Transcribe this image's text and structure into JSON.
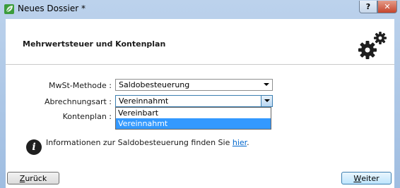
{
  "window": {
    "title": "Neues Dossier *",
    "help_label": "?",
    "close_label": "✕"
  },
  "header": {
    "title": "Mehrwertsteuer und Kontenplan",
    "icon": "gears-icon"
  },
  "form": {
    "mwst_label": "MwSt-Methode :",
    "mwst_value": "Saldobesteuerung",
    "abrechnungsart_label": "Abrechnungsart :",
    "abrechnungsart_value": "Vereinnahmt",
    "kontenplan_label": "Kontenplan :"
  },
  "dropdown": {
    "options": [
      "Vereinbart",
      "Vereinnahmt"
    ],
    "selected_index": 1
  },
  "info": {
    "text": "Informationen zur Saldobesteuerung finden Sie ",
    "link": "hier",
    "suffix": "."
  },
  "buttons": {
    "back_first": "Z",
    "back_rest": "urück",
    "next_first": "W",
    "next_rest": "eiter"
  },
  "colors": {
    "selection": "#3399ff",
    "link": "#0066cc",
    "title_bar": "#9fbde1"
  }
}
